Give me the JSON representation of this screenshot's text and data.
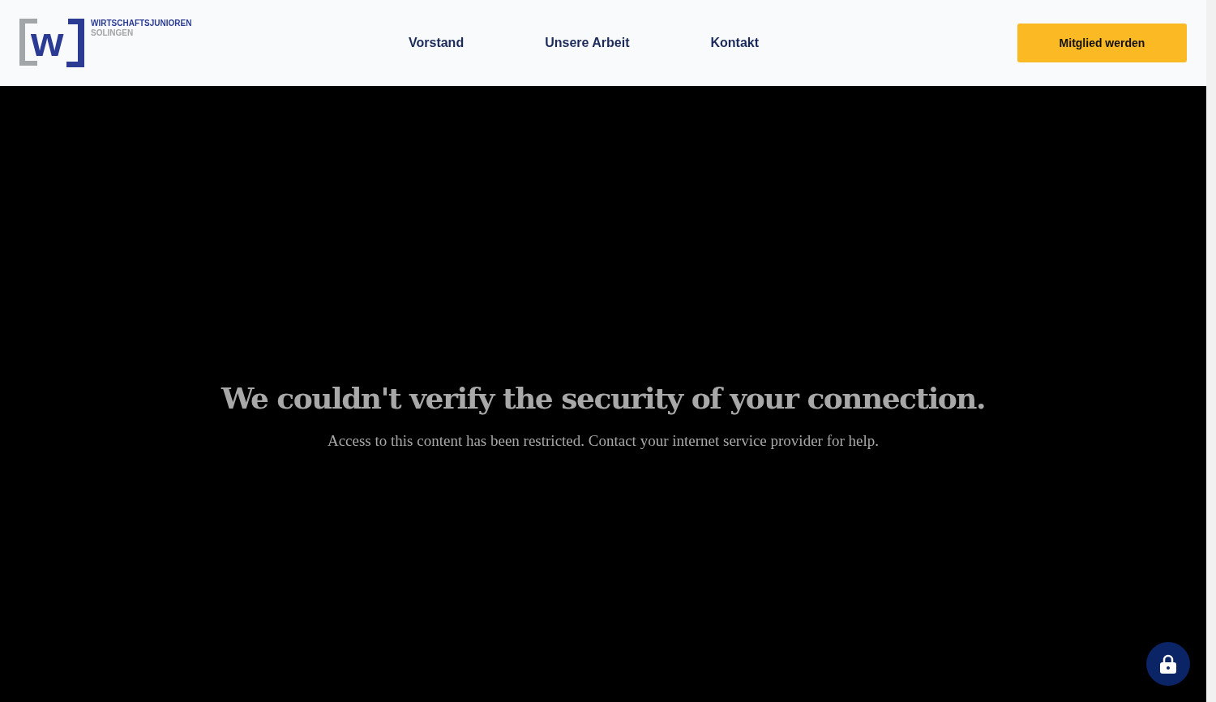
{
  "header": {
    "logo": {
      "mark": "w",
      "name": "WIRTSCHAFTSJUNIOREN",
      "city": "SOLINGEN"
    },
    "nav": [
      {
        "label": "Vorstand"
      },
      {
        "label": "Unsere Arbeit"
      },
      {
        "label": "Kontakt"
      }
    ],
    "cta": "Mitglied werden"
  },
  "message": {
    "title": "We couldn't verify the security of your connection.",
    "body": "Access to this content has been restricted. Contact your internet service provider for help."
  }
}
